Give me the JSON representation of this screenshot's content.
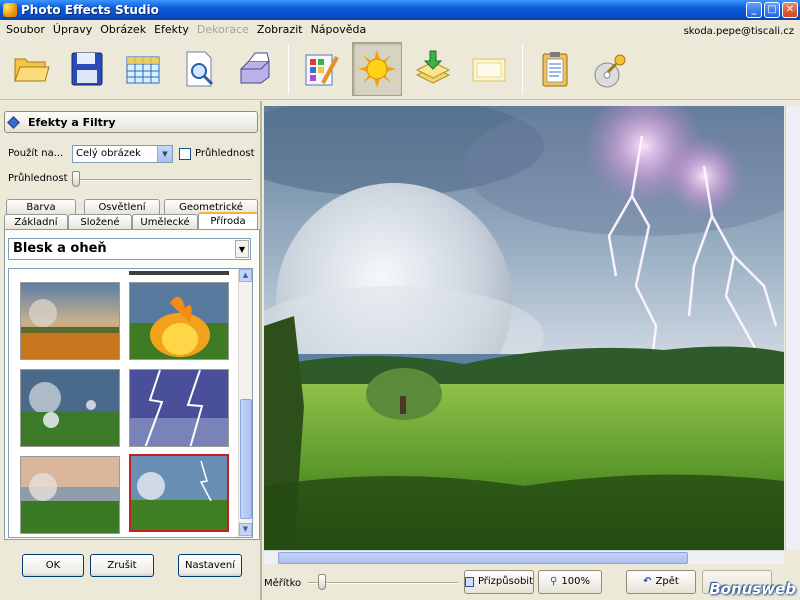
{
  "window": {
    "title": "Photo Effects Studio",
    "buttons": [
      "_",
      "□",
      "✕"
    ]
  },
  "menu": {
    "items": [
      {
        "label": "Soubor",
        "enabled": true
      },
      {
        "label": "Úpravy",
        "enabled": true
      },
      {
        "label": "Obrázek",
        "enabled": true
      },
      {
        "label": "Efekty",
        "enabled": true
      },
      {
        "label": "Dekorace",
        "enabled": false
      },
      {
        "label": "Zobrazit",
        "enabled": true
      },
      {
        "label": "Nápověda",
        "enabled": true
      }
    ],
    "user_email": "skoda.pepe@tiscali.cz"
  },
  "toolbar": {
    "buttons": [
      {
        "icon": "open-folder-icon"
      },
      {
        "icon": "save-floppy-icon"
      },
      {
        "icon": "grid-icon"
      },
      {
        "icon": "preview-document-icon"
      },
      {
        "icon": "printer-icon"
      },
      {
        "icon": "palette-pencil-icon"
      },
      {
        "icon": "sun-effects-icon",
        "pressed": true
      },
      {
        "icon": "layers-import-icon"
      },
      {
        "icon": "blank-frame-icon"
      },
      {
        "icon": "clipboard-icon"
      },
      {
        "icon": "cd-key-icon"
      }
    ]
  },
  "left_panel": {
    "header": "Efekty a Filtry",
    "apply_label": "Použít na...",
    "apply_value": "Celý obrázek",
    "opacity_checkbox_label": "Průhlednost",
    "opacity_checked": false,
    "opacity_slider_label": "Průhlednost",
    "opacity_slider_value": 0,
    "tabs_row1": [
      "Barva",
      "Osvětlení",
      "Geometrické"
    ],
    "tabs_row2": [
      "Základní",
      "Složené",
      "Umělecké",
      "Příroda"
    ],
    "active_tab": "Příroda",
    "effect_select": "Blesk a oheň",
    "thumbnails_selected_index": 5,
    "buttons": {
      "ok": "OK",
      "cancel": "Zrušit",
      "settings": "Nastavení"
    }
  },
  "status": {
    "scale_label": "Měřítko",
    "fit_label": "Přizpůsobit",
    "zoom_label": "100%",
    "back_label": "Zpět",
    "watermark": "Bonusweb"
  }
}
